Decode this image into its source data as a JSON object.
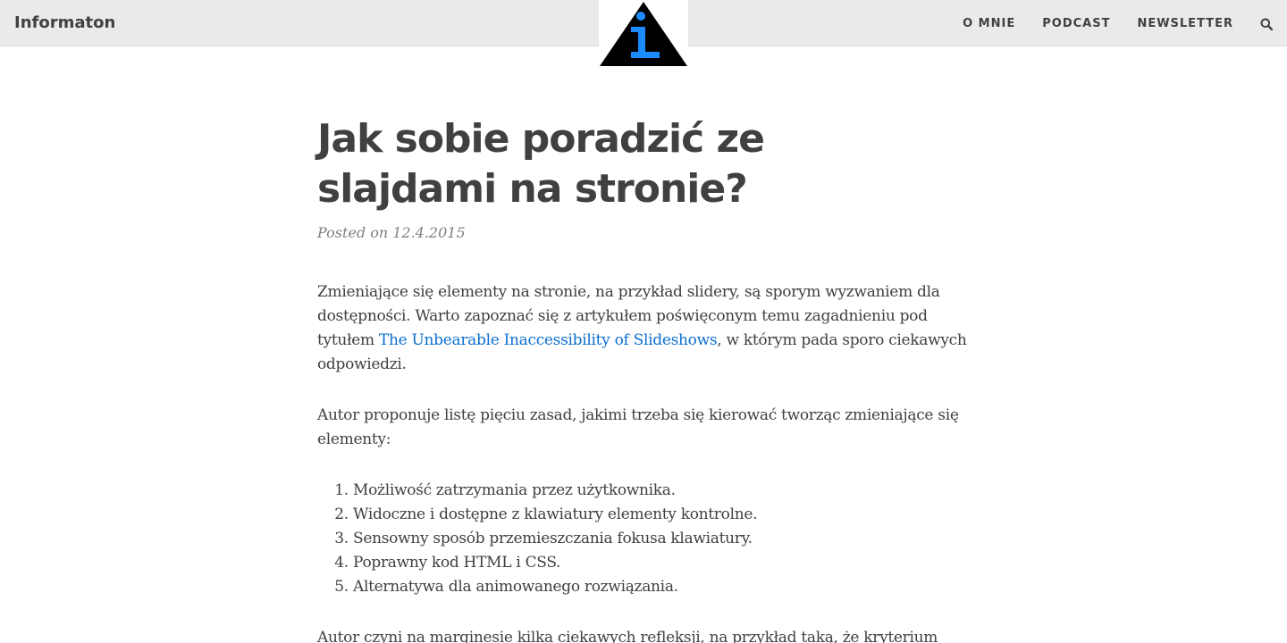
{
  "navbar": {
    "brand": "Informaton",
    "links": [
      "O MNIE",
      "PODCAST",
      "NEWSLETTER"
    ],
    "search_icon": "search-icon"
  },
  "logo": {
    "icon": "info-triangle-logo",
    "colors": {
      "triangle": "#000000",
      "letter": "#1a8cff"
    }
  },
  "article": {
    "title": "Jak sobie poradzić ze slajdami na stronie?",
    "meta": "Posted on 12.4.2015",
    "p1_before": "Zmieniające się elementy na stronie, na przykład slidery, są sporym wyzwaniem dla dostępności. Warto zapoznać się z artykułem poświęconym temu zagadnieniu pod tytułem ",
    "p1_link": "The Unbearable Inaccessibility of Slideshows",
    "p1_after": ", w którym pada sporo ciekawych odpowiedzi.",
    "p2": "Autor proponuje listę pięciu zasad, jakimi trzeba się kierować tworząc zmieniające się elementy:",
    "list": [
      "Możliwość zatrzymania przez użytkownika.",
      "Widoczne i dostępne z klawiatury elementy kontrolne.",
      "Sensowny sposób przemieszczania fokusa klawiatury.",
      "Poprawny kod HTML i CSS.",
      "Alternatywa dla animowanego rozwiązania."
    ],
    "p3": "Autor czyni na marginesie kilka ciekawych refleksji, na przykład taką, że kryterium"
  },
  "colors": {
    "navbar_bg": "#eaeaea",
    "text": "#404040",
    "link": "#0b6fd1",
    "meta": "#808080"
  }
}
